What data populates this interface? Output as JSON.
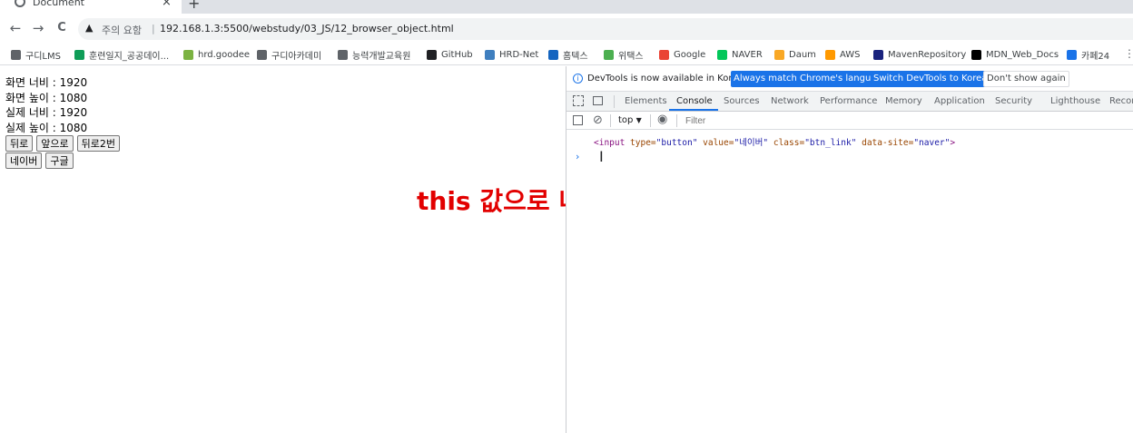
{
  "browser": {
    "tab_title": "Document",
    "tab_close": "×",
    "new_tab": "+",
    "back": "←",
    "forward": "→",
    "reload": "C",
    "security_text": "주의 요함",
    "url": "192.168.1.3:5500/webstudy/03_JS/12_browser_object.html",
    "bookmarks": [
      {
        "label": "구디LMS",
        "color": "#5f6368",
        "icon": "globe-icon"
      },
      {
        "label": "훈련일지_공공데이...",
        "color": "#0f9d58",
        "icon": "plus-icon"
      },
      {
        "label": "hrd.goodee",
        "color": "#7cb342",
        "icon": "dot-icon"
      },
      {
        "label": "구디아카데미",
        "color": "#5f6368",
        "icon": "globe-icon"
      },
      {
        "label": "능력개발교육원",
        "color": "#5f6368",
        "icon": "globe-icon"
      },
      {
        "label": "GitHub",
        "color": "#202124",
        "icon": "github-icon"
      },
      {
        "label": "HRD-Net",
        "color": "#3f7fbf",
        "icon": "hrdnet-icon"
      },
      {
        "label": "홈텍스",
        "color": "#1565c0",
        "icon": "hometax-icon"
      },
      {
        "label": "위택스",
        "color": "#4caf50",
        "icon": "wetax-icon"
      },
      {
        "label": "Google",
        "color": "#ea4335",
        "icon": "google-icon"
      },
      {
        "label": "NAVER",
        "color": "#03c75a",
        "icon": "naver-icon"
      },
      {
        "label": "Daum",
        "color": "#f9a825",
        "icon": "daum-icon"
      },
      {
        "label": "AWS",
        "color": "#ff9900",
        "icon": "aws-icon"
      },
      {
        "label": "MavenRepository",
        "color": "#1a237e",
        "icon": "maven-icon"
      },
      {
        "label": "MDN_Web_Docs",
        "color": "#000000",
        "icon": "mdn-icon"
      },
      {
        "label": "카페24",
        "color": "#1a73e8",
        "icon": "cafe24-icon"
      }
    ]
  },
  "page": {
    "lines": [
      "화면 너비 : 1920",
      "화면 높이 : 1080",
      "실제 너비 : 1920",
      "실제 높이 : 1080"
    ],
    "buttons_row1": [
      "뒤로",
      "앞으로",
      "뒤로2번"
    ],
    "buttons_row2": [
      "네이버",
      "구글"
    ],
    "annotation": "this 값으로 네이버 넘어"
  },
  "devtools": {
    "info_message": "DevTools is now available in Korean!",
    "btn_always_match": "Always match Chrome's language",
    "btn_switch": "Switch DevTools to Korean",
    "btn_dont_show": "Don't show again",
    "tabs": [
      "Elements",
      "Console",
      "Sources",
      "Network",
      "Performance",
      "Memory",
      "Application",
      "Security",
      "Lighthouse",
      "Recorder"
    ],
    "active_tab": "Console",
    "context": "top",
    "filter_placeholder": "Filter",
    "log": {
      "open": "<input",
      "type_attr": " type=",
      "type_val": "\"button\"",
      "value_attr": " value=",
      "value_val": "\"네이버\"",
      "class_attr": " class=",
      "class_val": "\"btn_link\"",
      "site_attr": " data-site=",
      "site_val": "\"naver\"",
      "close": ">"
    },
    "prompt": "›",
    "cursor": "I"
  }
}
